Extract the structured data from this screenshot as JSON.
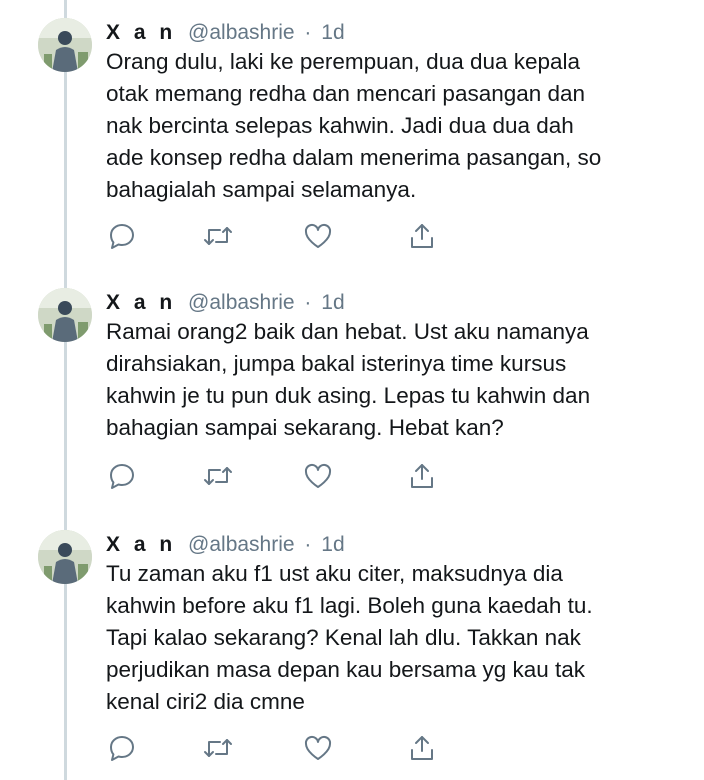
{
  "tweets": [
    {
      "name": "X a n",
      "handle": "@albashrie",
      "separator": "·",
      "time": "1d",
      "text": "Orang dulu, laki ke perempuan, dua dua kepala\notak memang redha dan mencari pasangan dan\nnak bercinta selepas kahwin. Jadi dua dua dah\nade konsep redha dalam menerima pasangan, so\nbahagialah sampai selamanya."
    },
    {
      "name": "X a n",
      "handle": "@albashrie",
      "separator": "·",
      "time": "1d",
      "text": "Ramai orang2 baik dan hebat. Ust aku namanya\ndirahsiakan, jumpa bakal isterinya time kursus\nkahwin je tu pun duk asing. Lepas tu kahwin dan\nbahagian sampai sekarang. Hebat kan?"
    },
    {
      "name": "X a n",
      "handle": "@albashrie",
      "separator": "·",
      "time": "1d",
      "text": "Tu zaman aku f1 ust aku citer, maksudnya dia\nkahwin before aku f1 lagi. Boleh guna kaedah tu.\nTapi kalao sekarang? Kenal lah dlu. Takkan nak\nperjudikan masa depan kau bersama yg kau tak\nkenal ciri2 dia cmne"
    }
  ],
  "icons": [
    "reply-icon",
    "retweet-icon",
    "like-icon",
    "share-icon"
  ],
  "colors": {
    "text": "#14171a",
    "secondary": "#657786",
    "thread_line": "#cfd9de"
  }
}
